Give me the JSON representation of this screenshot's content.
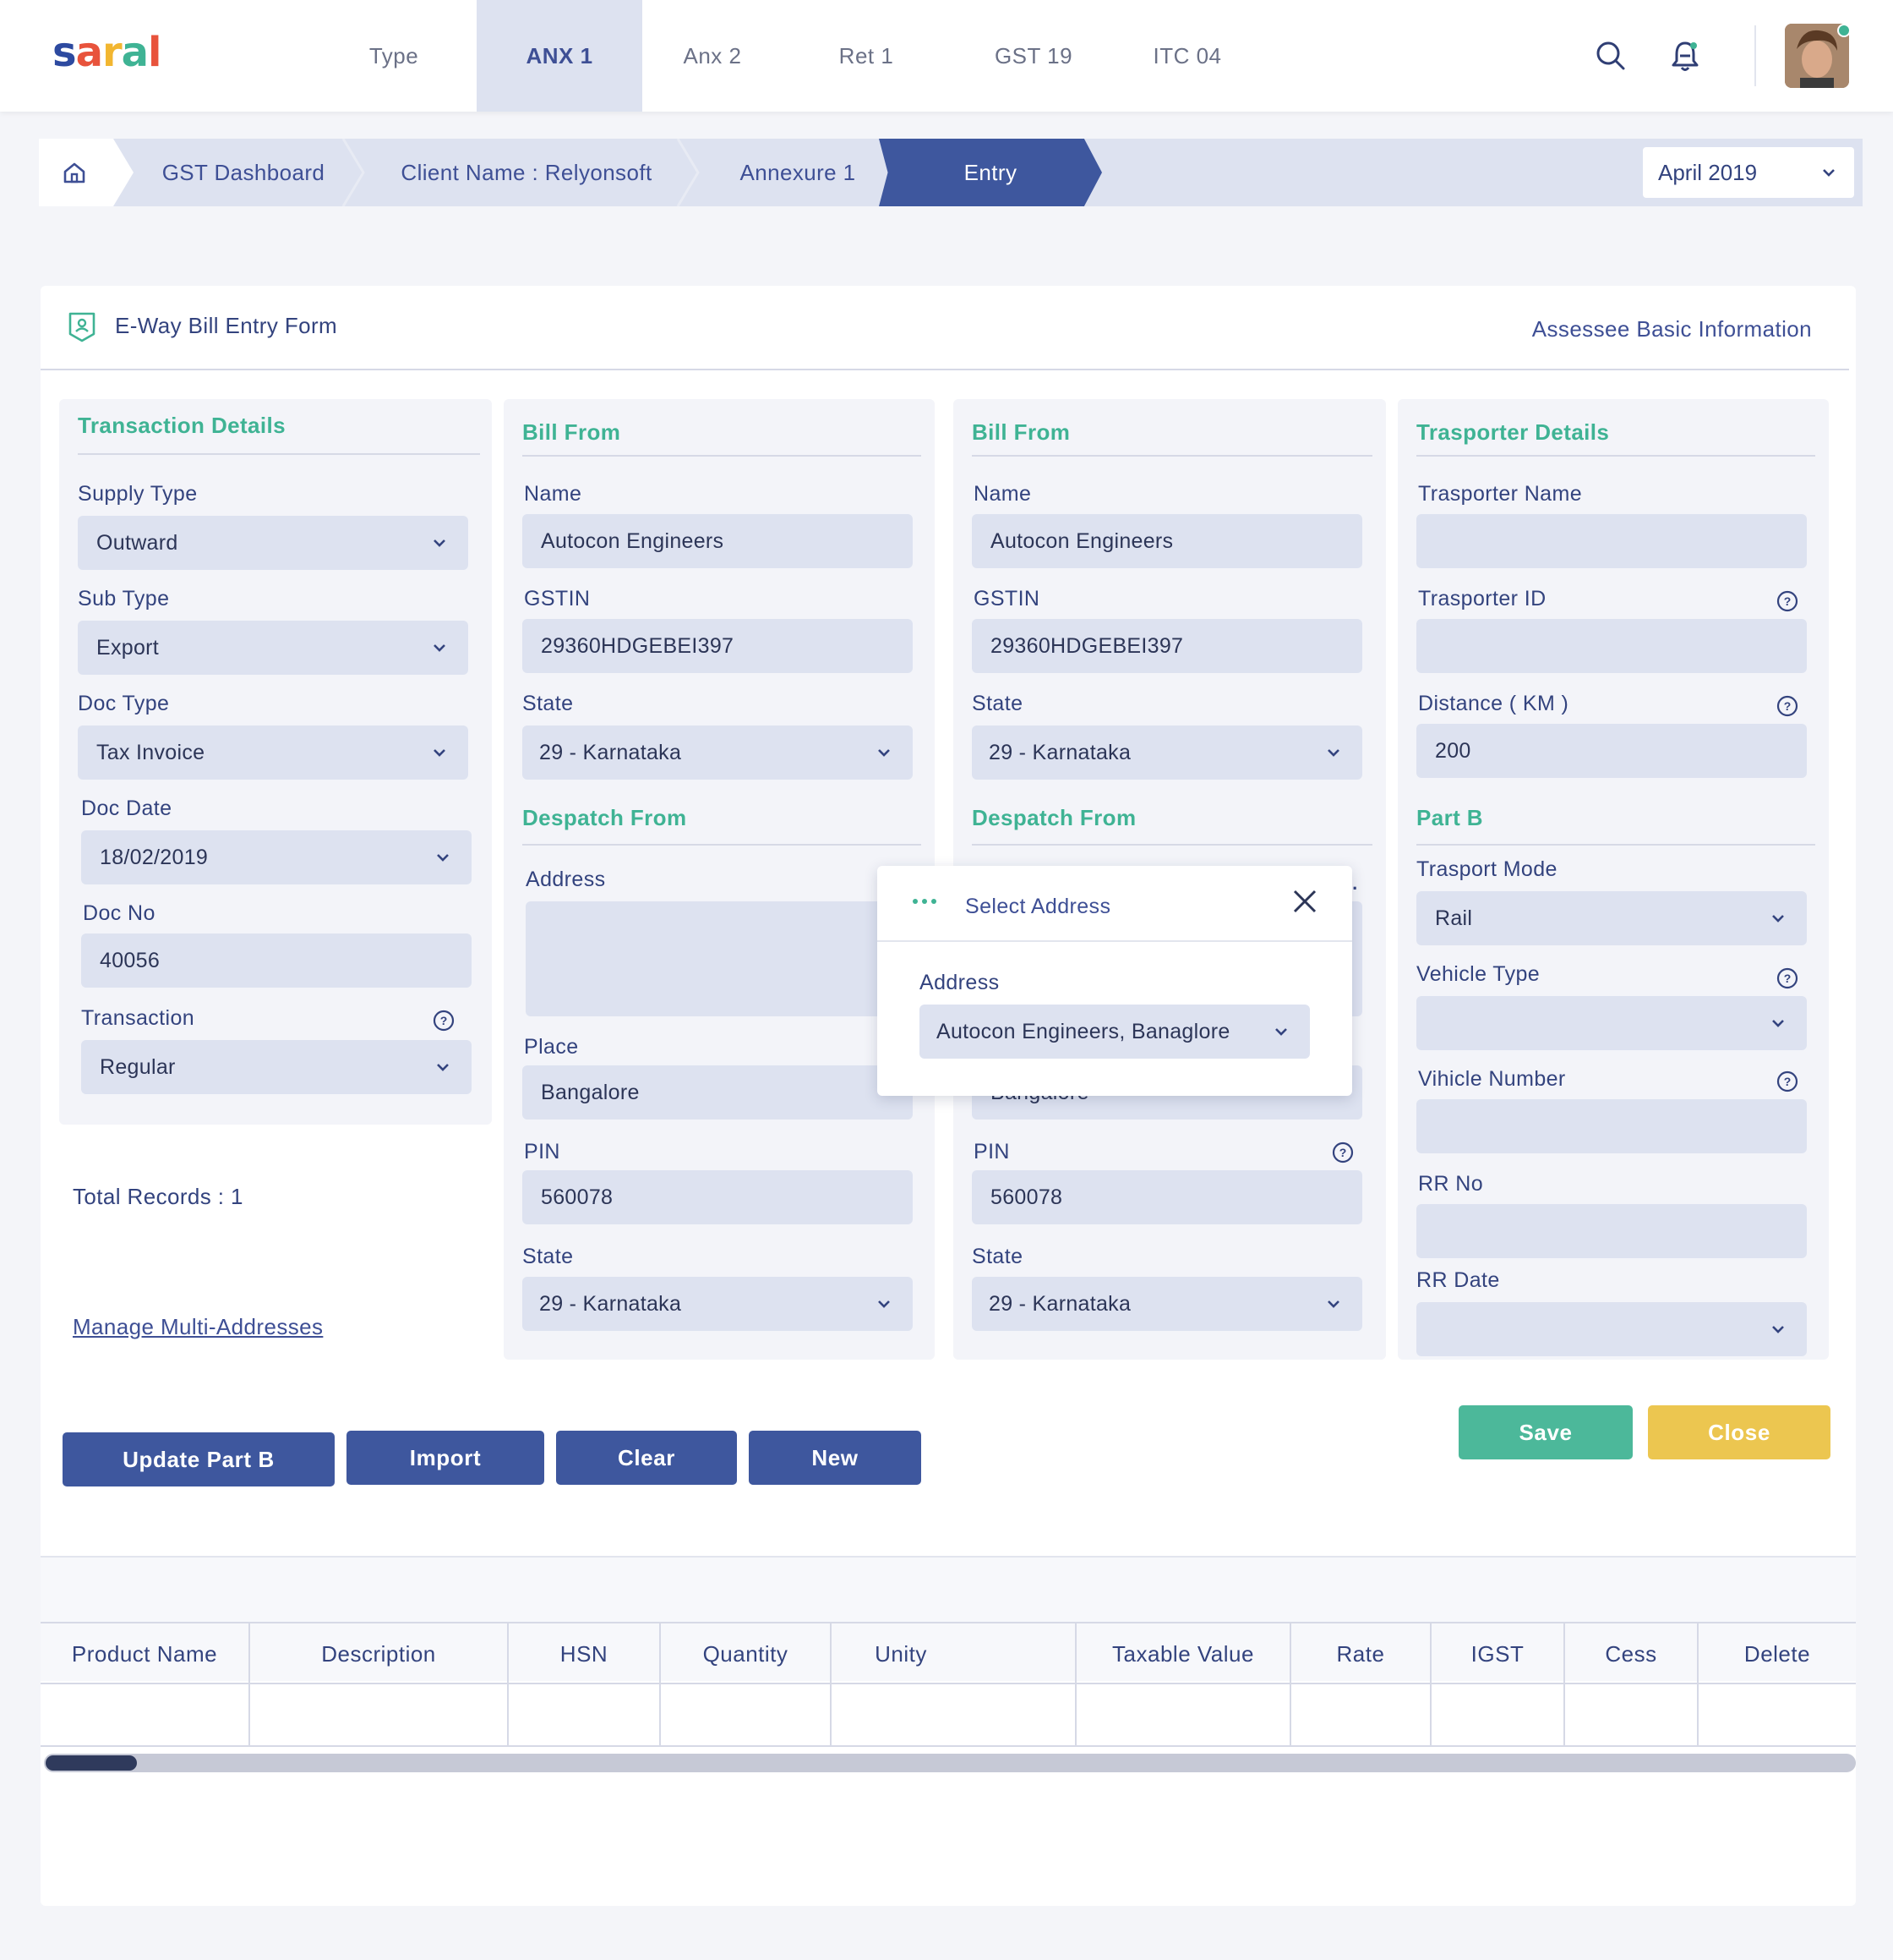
{
  "brand": {
    "logo": "saral"
  },
  "nav": {
    "tabs": [
      {
        "label": "Type"
      },
      {
        "label": "ANX 1"
      },
      {
        "label": "Anx 2"
      },
      {
        "label": "Ret 1"
      },
      {
        "label": "GST 19"
      },
      {
        "label": "ITC 04"
      }
    ],
    "active": "ANX 1"
  },
  "breadcrumb": {
    "items": [
      "GST Dashboard",
      "Client Name : Relyonsoft",
      "Annexure 1",
      "Entry"
    ],
    "month": "April 2019"
  },
  "form": {
    "title": "E-Way Bill Entry Form",
    "assessee_link": "Assessee Basic Information",
    "transaction": {
      "title": "Transaction Details",
      "supply_type_label": "Supply Type",
      "supply_type": "Outward",
      "sub_type_label": "Sub Type",
      "sub_type": "Export",
      "doc_type_label": "Doc Type",
      "doc_type": "Tax Invoice",
      "doc_date_label": "Doc Date",
      "doc_date": "18/02/2019",
      "doc_no_label": "Doc No",
      "doc_no": "40056",
      "transaction_label": "Transaction",
      "transaction": "Regular"
    },
    "total_records": "Total Records : 1",
    "manage_link": "Manage Multi-Addresses",
    "bill_from_1": {
      "title": "Bill From",
      "name_label": "Name",
      "name": "Autocon Engineers",
      "gstin_label": "GSTIN",
      "gstin": "29360HDGEBEI397",
      "state_label": "State",
      "state": "29 - Karnataka",
      "despatch_title": "Despatch From",
      "address_label": "Address",
      "address": "",
      "place_label": "Place",
      "place": "Bangalore",
      "pin_label": "PIN",
      "pin": "560078",
      "state2_label": "State",
      "state2": "29 - Karnataka"
    },
    "bill_from_2": {
      "title": "Bill From",
      "name_label": "Name",
      "name": "Autocon Engineers",
      "gstin_label": "GSTIN",
      "gstin": "29360HDGEBEI397",
      "state_label": "State",
      "state": "29 - Karnataka",
      "despatch_title": "Despatch From",
      "place": "Bangalore",
      "pin_label": "PIN",
      "pin": "560078",
      "state2_label": "State",
      "state2": "29 - Karnataka"
    },
    "transporter": {
      "title": "Trasporter Details",
      "name_label": "Trasporter Name",
      "name": "",
      "id_label": "Trasporter ID",
      "id": "",
      "distance_label": "Distance ( KM )",
      "distance": "200",
      "partb_title": "Part B",
      "mode_label": "Trasport Mode",
      "mode": "Rail",
      "vehicle_type_label": "Vehicle Type",
      "vehicle_type": "",
      "vehicle_number_label": "Vihicle Number",
      "vehicle_number": "",
      "rr_no_label": "RR No",
      "rr_no": "",
      "rr_date_label": "RR Date",
      "rr_date": ""
    },
    "buttons": {
      "update_part_b": "Update Part B",
      "import": "Import",
      "clear": "Clear",
      "new": "New",
      "save": "Save",
      "close": "Close"
    }
  },
  "popup": {
    "title": "Select Address",
    "address_label": "Address",
    "address_value": "Autocon Engineers, Banaglore"
  },
  "table": {
    "columns": [
      "Product Name",
      "Description",
      "HSN",
      "Quantity",
      "Unity",
      "Taxable Value",
      "Rate",
      "IGST",
      "Cess",
      "Delete"
    ],
    "rows": [],
    "scroll_position": 0.0
  },
  "colors": {
    "primary": "#3e579e",
    "accent_green": "#3fb394",
    "save_green": "#4cb89a",
    "close_yellow": "#ecc650",
    "field_bg": "#dde2f0"
  }
}
